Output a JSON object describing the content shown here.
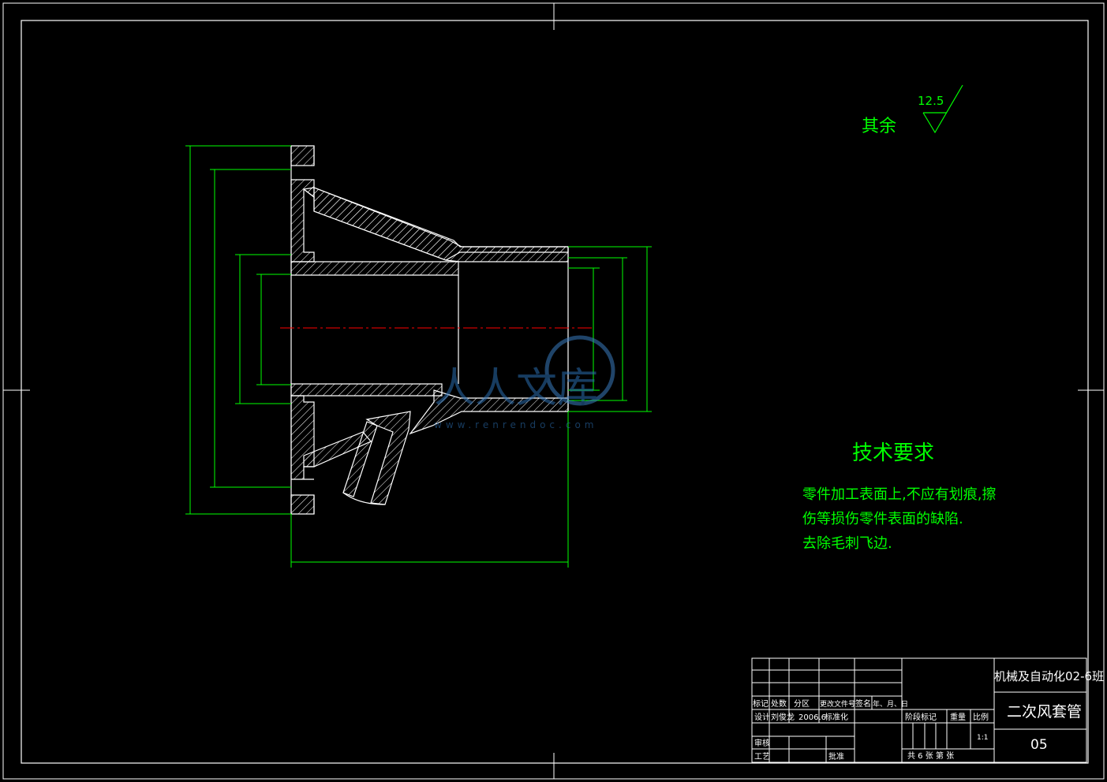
{
  "surface_finish": {
    "label": "其余",
    "value": "12.5"
  },
  "technical_requirements": {
    "title": "技术要求",
    "lines": [
      "零件加工表面上,不应有划痕,擦",
      "伤等损伤零件表面的缺陷.",
      "去除毛刺飞边."
    ]
  },
  "title_block": {
    "class_name": "机械及自动化02-6班",
    "part_name": "二次风套管",
    "drawing_number": "05",
    "scale": "1:1",
    "revision_headers": [
      "标记",
      "处数",
      "分区",
      "更改文件号",
      "签名",
      "年、月、日"
    ],
    "design_label": "设计",
    "designer": "刘俊龙",
    "date": "2006.6",
    "standardize_label": "标准化",
    "review_label": "审核",
    "process_label": "工艺",
    "approve_label": "批准",
    "stage_mark_label": "阶段标记",
    "weight_label": "重量",
    "scale_label": "比例",
    "sheets_text": "共 6 张  第  张"
  },
  "watermark": {
    "text": "人人文库",
    "url": "www.renrendoc.com"
  },
  "colors": {
    "background": "#000000",
    "geometry": "#ffffff",
    "dimension": "#00ff00",
    "hatch": "#ffffff",
    "centerline": "#ff0000",
    "frame": "#ffffff"
  }
}
